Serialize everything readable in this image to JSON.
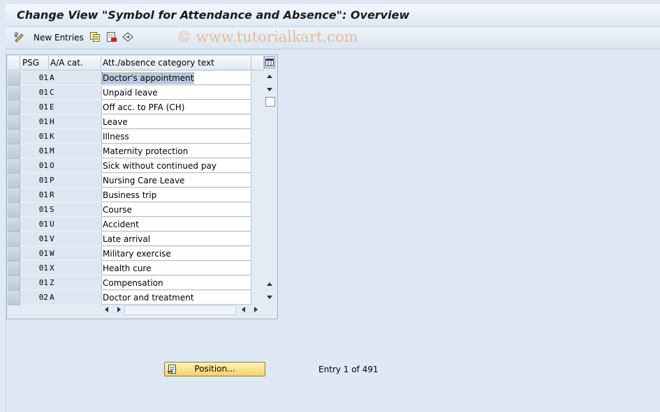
{
  "title": "Change View \"Symbol for Attendance and Absence\": Overview",
  "watermark": "© www.tutorialkart.com",
  "toolbar": {
    "new_entries_label": "New Entries",
    "icons": [
      "display-change-icon",
      "copy-icon",
      "delete-icon",
      "undo-icon"
    ]
  },
  "table": {
    "headers": {
      "psg": "PSG",
      "cat": "A/A cat.",
      "text": "Att./absence category text"
    },
    "rows": [
      {
        "psg": "01",
        "cat": "A",
        "text": "Doctor's appointment"
      },
      {
        "psg": "01",
        "cat": "C",
        "text": "Unpaid leave"
      },
      {
        "psg": "01",
        "cat": "E",
        "text": "Off acc. to PFA (CH)"
      },
      {
        "psg": "01",
        "cat": "H",
        "text": "Leave"
      },
      {
        "psg": "01",
        "cat": "K",
        "text": "Illness"
      },
      {
        "psg": "01",
        "cat": "M",
        "text": "Maternity protection"
      },
      {
        "psg": "01",
        "cat": "O",
        "text": "Sick without continued pay"
      },
      {
        "psg": "01",
        "cat": "P",
        "text": "Nursing Care Leave"
      },
      {
        "psg": "01",
        "cat": "R",
        "text": "Business trip"
      },
      {
        "psg": "01",
        "cat": "S",
        "text": "Course"
      },
      {
        "psg": "01",
        "cat": "U",
        "text": "Accident"
      },
      {
        "psg": "01",
        "cat": "V",
        "text": "Late arrival"
      },
      {
        "psg": "01",
        "cat": "W",
        "text": "Military exercise"
      },
      {
        "psg": "01",
        "cat": "X",
        "text": "Health cure"
      },
      {
        "psg": "01",
        "cat": "Z",
        "text": "Compensation"
      },
      {
        "psg": "02",
        "cat": "A",
        "text": "Doctor and treatment"
      }
    ]
  },
  "position_button": "Position...",
  "entry_info": "Entry 1 of 491"
}
